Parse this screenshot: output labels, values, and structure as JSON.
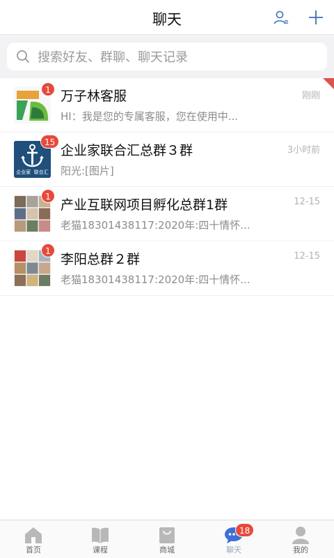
{
  "header": {
    "title": "聊天",
    "contacts_icon": "contacts-icon",
    "add_icon": "plus-icon"
  },
  "search": {
    "placeholder": "搜索好友、群聊、聊天记录",
    "icon": "search-icon"
  },
  "chats": [
    {
      "name": "万子林客服",
      "preview": "HI：我是您的专属客服，您在使用中...",
      "time": "刚刚",
      "badge": "1",
      "pinned": true
    },
    {
      "name": "企业家联合汇总群３群",
      "preview": "阳光:[图片]",
      "time": "3小时前",
      "badge": "15",
      "avatar_text": "企业家  联合汇"
    },
    {
      "name": "产业互联网项目孵化总群1群",
      "preview": "老猫18301438117:2020年:四十情怀...",
      "time": "12-15",
      "badge": "1"
    },
    {
      "name": "李阳总群２群",
      "preview": "老猫18301438117:2020年:四十情怀...",
      "time": "12-15",
      "badge": "1"
    }
  ],
  "tabs": [
    {
      "label": "首页",
      "icon": "home-icon"
    },
    {
      "label": "课程",
      "icon": "book-icon"
    },
    {
      "label": "商城",
      "icon": "shop-bag-icon"
    },
    {
      "label": "聊天",
      "icon": "chat-bubble-icon",
      "badge": "18",
      "active": true
    },
    {
      "label": "我的",
      "icon": "profile-icon"
    }
  ],
  "colors": {
    "badge": "#e64a3c",
    "accent": "#3d6fd6",
    "icon_gray": "#b8b8b8"
  }
}
